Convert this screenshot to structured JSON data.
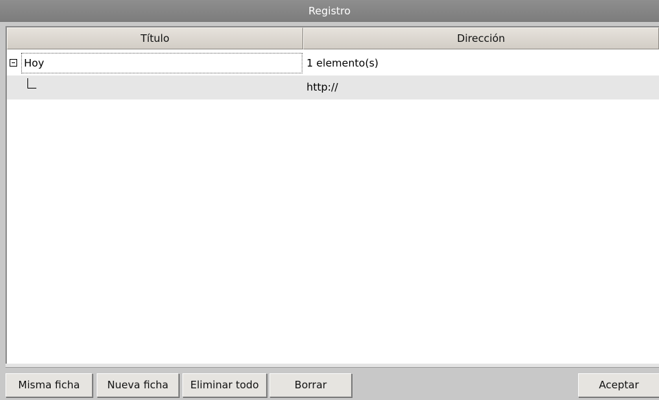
{
  "window": {
    "title": "Registro"
  },
  "table": {
    "columns": [
      "Título",
      "Dirección"
    ],
    "rows": [
      {
        "title": "Hoy",
        "address": "1 elemento(s)",
        "expanded": true
      },
      {
        "title": "",
        "address": "http://"
      }
    ]
  },
  "buttons": {
    "same_tab": "Misma ficha",
    "new_tab": "Nueva ficha",
    "delete_all": "Eliminar todo",
    "delete": "Borrar",
    "accept": "Aceptar"
  },
  "icons": {
    "collapse": "minus-box-icon",
    "tree_branch": "tree-elbow-icon"
  },
  "colors": {
    "titlebar": "#7c7c7c",
    "selected_row": "#e6e6e6",
    "window_bg": "#c8c8c8"
  }
}
